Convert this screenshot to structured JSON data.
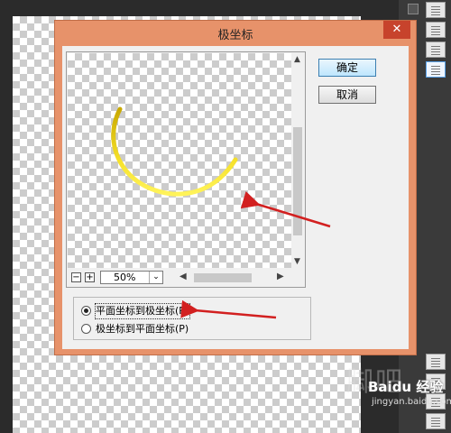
{
  "dialog": {
    "title": "极坐标",
    "close_glyph": "✕",
    "ok_label": "确定",
    "cancel_label": "取消"
  },
  "preview": {
    "zoom_value": "50%",
    "zoom_out_glyph": "−",
    "zoom_in_glyph": "+",
    "dropdown_glyph": "⌄"
  },
  "options": {
    "rect_to_polar": "平面坐标到极坐标(R)",
    "polar_to_rect": "极坐标到平面坐标(P)",
    "selected": "rect_to_polar"
  },
  "watermark": {
    "big": "脚吧",
    "text": "Baidu 经验",
    "url": "jingyan.baidu.com"
  },
  "colors": {
    "title_bar": "#e7926a",
    "close_button": "#c7432c",
    "annotation_arrow": "#d22020",
    "arc": "#f2d51a"
  }
}
